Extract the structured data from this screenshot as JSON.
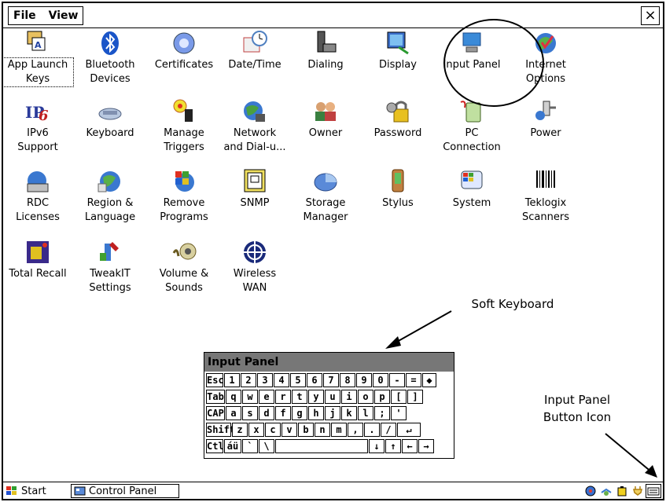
{
  "menubar": {
    "file": "File",
    "view": "View",
    "close": "×"
  },
  "icons": [
    {
      "label": "App Launch\nKeys",
      "icon": "app-launch-keys-icon"
    },
    {
      "label": "Bluetooth\nDevices",
      "icon": "bluetooth-icon"
    },
    {
      "label": "Certificates",
      "icon": "certificates-icon"
    },
    {
      "label": "Date/Time",
      "icon": "date-time-icon"
    },
    {
      "label": "Dialing",
      "icon": "dialing-icon"
    },
    {
      "label": "Display",
      "icon": "display-icon"
    },
    {
      "label": "Input Panel",
      "icon": "input-panel-icon"
    },
    {
      "label": "Internet\nOptions",
      "icon": "internet-options-icon"
    },
    {
      "label": "IPv6\nSupport",
      "icon": "ipv6-icon"
    },
    {
      "label": "Keyboard",
      "icon": "keyboard-icon"
    },
    {
      "label": "Manage\nTriggers",
      "icon": "manage-triggers-icon"
    },
    {
      "label": "Network\nand Dial-u...",
      "icon": "network-icon"
    },
    {
      "label": "Owner",
      "icon": "owner-icon"
    },
    {
      "label": "Password",
      "icon": "password-icon"
    },
    {
      "label": "PC\nConnection",
      "icon": "pc-connection-icon"
    },
    {
      "label": "Power",
      "icon": "power-icon"
    },
    {
      "label": "RDC\nLicenses",
      "icon": "rdc-licenses-icon"
    },
    {
      "label": "Region &\nLanguage",
      "icon": "region-language-icon"
    },
    {
      "label": "Remove\nPrograms",
      "icon": "remove-programs-icon"
    },
    {
      "label": "SNMP",
      "icon": "snmp-icon"
    },
    {
      "label": "Storage\nManager",
      "icon": "storage-manager-icon"
    },
    {
      "label": "Stylus",
      "icon": "stylus-icon"
    },
    {
      "label": "System",
      "icon": "system-icon"
    },
    {
      "label": "Teklogix\nScanners",
      "icon": "barcode-scanner-icon"
    },
    {
      "label": "Total Recall",
      "icon": "total-recall-icon"
    },
    {
      "label": "TweakIT\nSettings",
      "icon": "tweakit-icon"
    },
    {
      "label": "Volume &\nSounds",
      "icon": "volume-icon"
    },
    {
      "label": "Wireless\nWAN",
      "icon": "wireless-wan-icon"
    }
  ],
  "annotations": {
    "soft_keyboard": "Soft Keyboard",
    "input_panel_button": "Input Panel\nButton Icon"
  },
  "input_panel": {
    "title": "Input Panel",
    "rows": [
      [
        "Esc",
        "1",
        "2",
        "3",
        "4",
        "5",
        "6",
        "7",
        "8",
        "9",
        "0",
        "-",
        "=",
        "◆"
      ],
      [
        "Tab",
        "q",
        "w",
        "e",
        "r",
        "t",
        "y",
        "u",
        "i",
        "o",
        "p",
        "[",
        "]"
      ],
      [
        "CAP",
        "a",
        "s",
        "d",
        "f",
        "g",
        "h",
        "j",
        "k",
        "l",
        ";",
        "'"
      ],
      [
        "Shift",
        "z",
        "x",
        "c",
        "v",
        "b",
        "n",
        "m",
        ",",
        ".",
        "/",
        "↵"
      ],
      [
        "Ctl",
        "áü",
        "`",
        "\\",
        " ",
        "↓",
        "↑",
        "←",
        "→"
      ]
    ]
  },
  "taskbar": {
    "start": "Start",
    "task": "Control Panel"
  }
}
